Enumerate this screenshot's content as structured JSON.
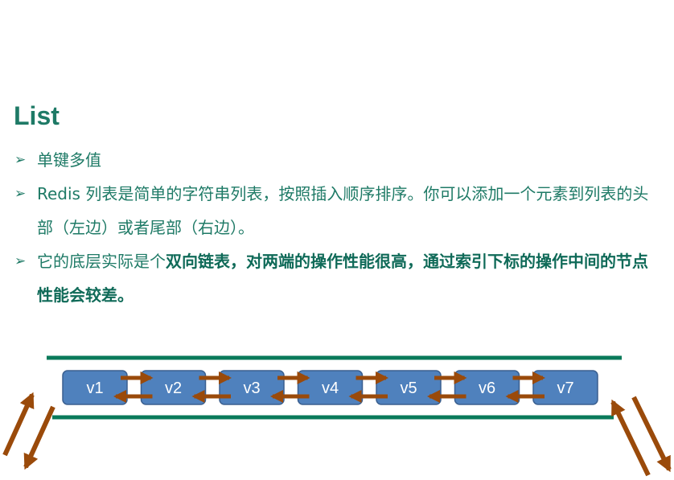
{
  "slide": {
    "title": "List",
    "bullets": [
      {
        "text": "单键多值"
      },
      {
        "text": "Redis 列表是简单的字符串列表，按照插入顺序排序。你可以添加一个元素到列表的头部（左边）或者尾部（右边）。"
      },
      {
        "pre": "它的底层实际是个",
        "bold": "双向链表，对两端的操作性能很高，通过索引下标的操作中间的节点性能会较差。"
      }
    ]
  },
  "diagram": {
    "nodes": [
      "v1",
      "v2",
      "v3",
      "v4",
      "v5",
      "v6",
      "v7"
    ],
    "colors": {
      "node_fill": "#4f81bd",
      "node_border": "#3a5f8f",
      "arrow": "#9a4a0a",
      "rail": "#0a7a5a",
      "text": "#1e7a66"
    },
    "icons": [
      "bullet-arrow-icon",
      "right-arrow-icon",
      "left-arrow-icon"
    ]
  }
}
